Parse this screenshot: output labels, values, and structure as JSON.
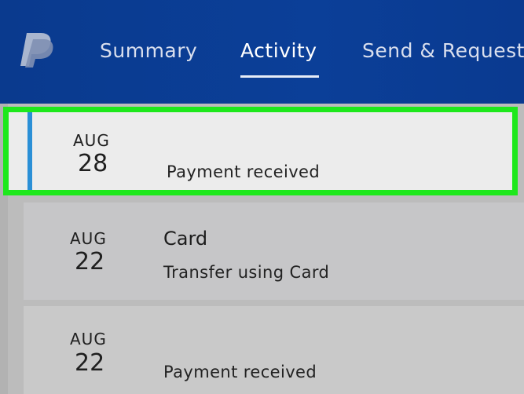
{
  "brand": {
    "logo_icon": "paypal-logo-icon"
  },
  "nav": {
    "items": [
      {
        "label": "Summary"
      },
      {
        "label": "Activity",
        "active": true
      },
      {
        "label": "Send & Request"
      }
    ]
  },
  "activity": {
    "items": [
      {
        "month": "AUG",
        "day": "28",
        "title": "",
        "subtitle": "Payment received",
        "selected": true
      },
      {
        "month": "AUG",
        "day": "22",
        "title": "Card",
        "subtitle": "Transfer using Card"
      },
      {
        "month": "AUG",
        "day": "22",
        "title": "",
        "subtitle": "Payment received"
      }
    ]
  },
  "colors": {
    "header_blue": "#0b3f98",
    "highlight_green": "#1ee81c",
    "selection_accent": "#2a8fd6"
  }
}
